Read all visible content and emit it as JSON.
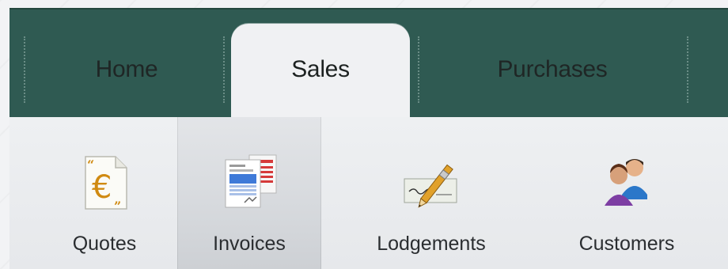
{
  "nav": {
    "tabs": [
      {
        "label": "Home",
        "active": false
      },
      {
        "label": "Sales",
        "active": true
      },
      {
        "label": "Purchases",
        "active": false
      }
    ]
  },
  "toolbar": {
    "items": [
      {
        "label": "Quotes",
        "icon": "quote-euro-icon",
        "selected": false
      },
      {
        "label": "Invoices",
        "icon": "invoice-document-icon",
        "selected": true
      },
      {
        "label": "Lodgements",
        "icon": "cheque-pen-icon",
        "selected": false
      },
      {
        "label": "Customers",
        "icon": "customers-people-icon",
        "selected": false
      }
    ]
  },
  "colors": {
    "header_bg": "#2f5a52",
    "active_tab_bg": "#f0f1f3",
    "quote_accent": "#d08a12",
    "invoice_red": "#d63a3a",
    "invoice_blue": "#3f7ad8"
  }
}
